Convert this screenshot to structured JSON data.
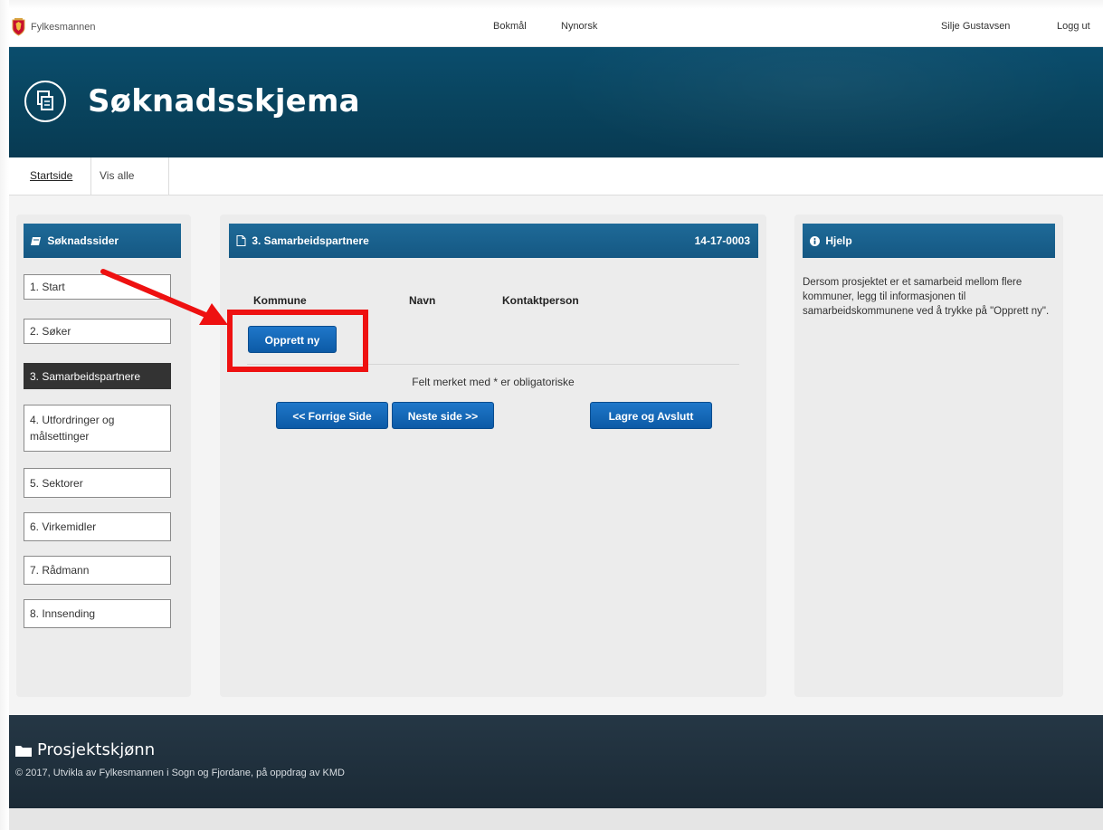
{
  "brand": {
    "name": "Fylkesmannen"
  },
  "languages": [
    "Bokmål",
    "Nynorsk"
  ],
  "user": {
    "name": "Silje Gustavsen",
    "logout": "Logg ut"
  },
  "hero": {
    "title": "Søknadsskjema"
  },
  "tabs": [
    "Startside",
    "Vis alle"
  ],
  "sidebar": {
    "title": "Søknadssider",
    "items": [
      "1. Start",
      "2. Søker",
      "3. Samarbeidspartnere",
      "4. Utfordringer og målsettinger",
      "5. Sektorer",
      "6. Virkemidler",
      "7. Rådmann",
      "8. Innsending"
    ],
    "active_index": 2
  },
  "form": {
    "title": "3. Samarbeidspartnere",
    "id": "14-17-0003",
    "columns": [
      "Kommune",
      "Navn",
      "Kontaktperson"
    ],
    "create_button": "Opprett ny",
    "required_note": "Felt merket med * er obligatoriske",
    "prev_button": "<< Forrige Side",
    "next_button": "Neste side >>",
    "save_button": "Lagre og Avslutt"
  },
  "help": {
    "title": "Hjelp",
    "text": "Dersom prosjektet er et samarbeid mellom flere kommuner, legg til informasjonen til samarbeidskommunene ved å trykke på \"Opprett ny\"."
  },
  "footer": {
    "title": "Prosjektskjønn",
    "copyright": "© 2017, Utvikla av Fylkesmannen i Sogn og Fjordane, på oppdrag av KMD"
  },
  "colors": {
    "hero": "#094560",
    "header_blue": "#1a6291",
    "button_blue": "#1466b8",
    "footer": "#1f2f3b",
    "annotation": "#ee1111"
  }
}
